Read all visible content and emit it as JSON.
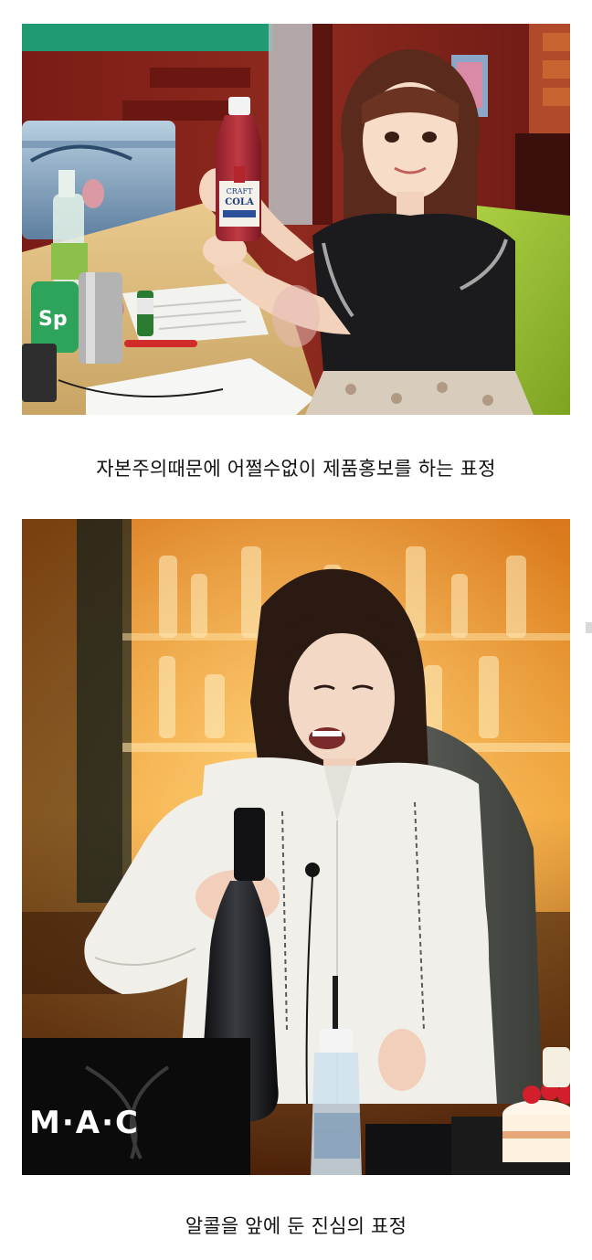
{
  "captions": {
    "first": "자본주의때문에 어쩔수없이 제품홍보를 하는 표정",
    "second": "알콜을 앞에 둔 진심의 표정"
  },
  "photo1": {
    "bottle_label_line1": "CRAFT",
    "bottle_label_line2": "COLA",
    "can_text": "Sp"
  },
  "photo2": {
    "bag_brand": "M·A·C"
  }
}
